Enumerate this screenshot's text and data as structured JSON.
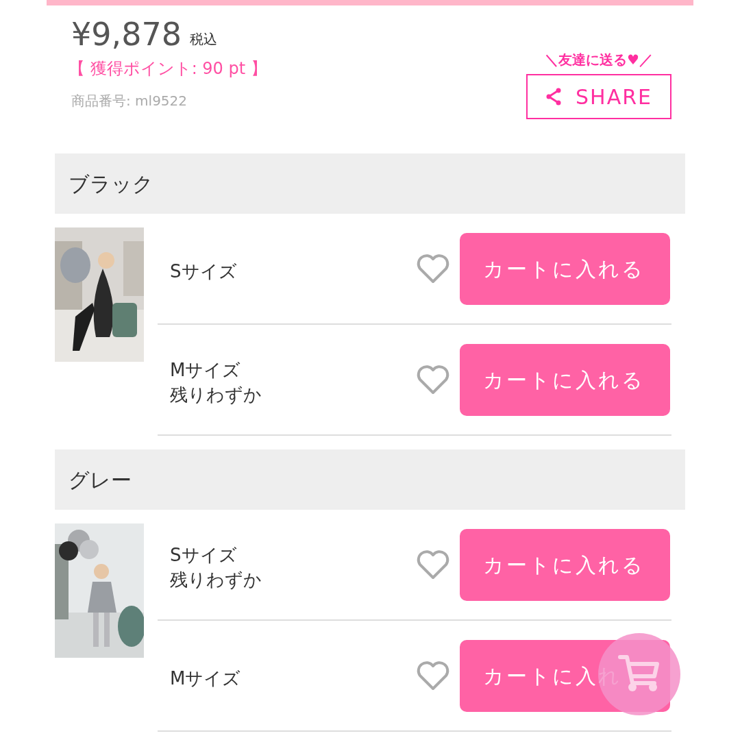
{
  "price": {
    "amount": "¥9,878",
    "tax": "税込"
  },
  "points": "【 獲得ポイント: 90 pt 】",
  "product_code": "商品番号: ml9522",
  "share": {
    "caption": "＼友達に送る♥／",
    "label": "SHARE"
  },
  "variants": [
    {
      "color_name": "ブラック",
      "sizes": [
        {
          "lines": [
            "Sサイズ"
          ],
          "favorite": false,
          "button": "カートに入れる"
        },
        {
          "lines": [
            "Mサイズ",
            "残りわずか"
          ],
          "favorite": false,
          "button": "カートに入れる"
        }
      ]
    },
    {
      "color_name": "グレー",
      "sizes": [
        {
          "lines": [
            "Sサイズ",
            "残りわずか"
          ],
          "favorite": false,
          "button": "カートに入れる"
        },
        {
          "lines": [
            "Mサイズ"
          ],
          "favorite": false,
          "button": "カートに入れ"
        }
      ]
    }
  ]
}
